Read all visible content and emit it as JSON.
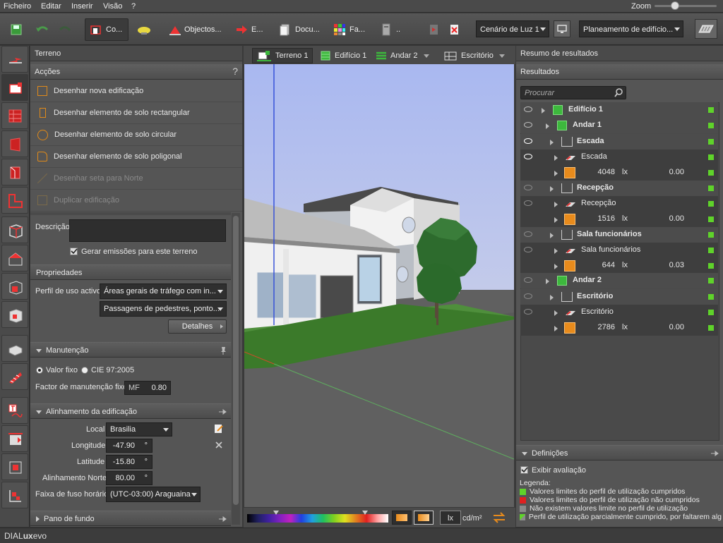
{
  "menu": {
    "items": [
      "Ficheiro",
      "Editar",
      "Inserir",
      "Visão",
      "?"
    ],
    "zoom_label": "Zoom"
  },
  "toolbar": {
    "construction": "Co...",
    "objects": "Objectos...",
    "export": "E...",
    "documentation": "Docu...",
    "colors": "Fa...",
    "more": "..",
    "light_scene": "Cenário de Luz 1",
    "planning": "Planeamento de edifício..."
  },
  "view_tabs": [
    {
      "label": "Terreno 1"
    },
    {
      "label": "Edifício 1"
    },
    {
      "label": "Andar 2"
    },
    {
      "label": "Escritório"
    }
  ],
  "left_panel": {
    "title": "Terreno",
    "actions_header": "Acções",
    "help": "?",
    "actions": [
      {
        "label": "Desenhar nova edificação",
        "enabled": true
      },
      {
        "label": "Desenhar elemento de solo rectangular",
        "enabled": true
      },
      {
        "label": "Desenhar elemento de solo circular",
        "enabled": true
      },
      {
        "label": "Desenhar elemento de solo poligonal",
        "enabled": true
      },
      {
        "label": "Desenhar seta para Norte",
        "enabled": false
      },
      {
        "label": "Duplicar edificação",
        "enabled": false
      }
    ],
    "description_label": "Descrição",
    "description_value": "",
    "emissions_checkbox": "Gerar emissões para este terreno",
    "emissions_checked": true,
    "properties": {
      "header": "Propriedades",
      "profile_label": "Perfil de uso activo",
      "profile_value1": "Áreas gerais de tráfego com in...",
      "profile_value2": "Passagens de pedestres, ponto...",
      "details_button": "Detalhes"
    },
    "maintenance": {
      "header": "Manutenção",
      "opt_fixed": "Valor fixo",
      "opt_cie": "CIE 97:2005",
      "selected": "Valor fixo",
      "factor_label": "Factor de manutenção fixo",
      "mf_prefix": "MF",
      "factor_value": "0.80"
    },
    "alignment": {
      "header": "Alinhamento da edificação",
      "local_label": "Local",
      "local_value": "Brasilia",
      "longitude_label": "Longitude",
      "longitude_value": "-47.90",
      "latitude_label": "Latitude",
      "latitude_value": "-15.80",
      "north_label": "Alinhamento Norte",
      "north_value": "80.00",
      "deg": "°",
      "timezone_label": "Faixa de fuso horário",
      "timezone_value": "(UTC-03:00) Araguaina"
    },
    "background": {
      "header": "Pano de fundo"
    }
  },
  "right_panel": {
    "summary_header": "Resumo de resultados",
    "results_header": "Resultados",
    "search_placeholder": "Procurar",
    "rows": [
      {
        "label": "Edifício 1",
        "bold": true
      },
      {
        "label": "Andar 1",
        "bold": true
      },
      {
        "label": "Escada",
        "bold": true
      },
      {
        "label": "Escada",
        "bold": false
      },
      {
        "value": "4048",
        "unit": "lx",
        "uniformity": "0.00"
      },
      {
        "label": "Recepção",
        "bold": true
      },
      {
        "label": "Recepção",
        "bold": false
      },
      {
        "value": "1516",
        "unit": "lx",
        "uniformity": "0.00"
      },
      {
        "label": "Sala funcionários",
        "bold": true
      },
      {
        "label": "Sala funcionários",
        "bold": false
      },
      {
        "value": "644",
        "unit": "lx",
        "uniformity": "0.03"
      },
      {
        "label": "Andar 2",
        "bold": true
      },
      {
        "label": "Escritório",
        "bold": true
      },
      {
        "label": "Escritório",
        "bold": false
      },
      {
        "value": "2786",
        "unit": "lx",
        "uniformity": "0.00"
      }
    ],
    "definitions": {
      "header": "Definições",
      "show_eval": "Exibir avaliação",
      "show_eval_checked": true,
      "legend_title": "Legenda:",
      "legend": [
        {
          "text": "Valores limites do perfil de utilização cumpridos",
          "color": "#5fd32a"
        },
        {
          "text": "Valores limites do perfil de utilização não cumpridos",
          "color": "#e02020"
        },
        {
          "text": "Não existem valores limite no perfil de utilização",
          "color": "#8a8a8a"
        },
        {
          "text": "Perfil de utilização parcialmente cumprido, por faltarem alg",
          "color": "#5fd32a"
        }
      ]
    }
  },
  "bottom_bar": {
    "unit_lx": "lx",
    "unit_cdm2": "cd/m²"
  },
  "status": {
    "app_name_part1": "DIAL",
    "app_name_part2": "ux",
    "app_name_part3": "evo"
  },
  "colors": {
    "accent_orange": "#e88b1c",
    "ok_green": "#5fd32a",
    "fail_red": "#e02020"
  }
}
